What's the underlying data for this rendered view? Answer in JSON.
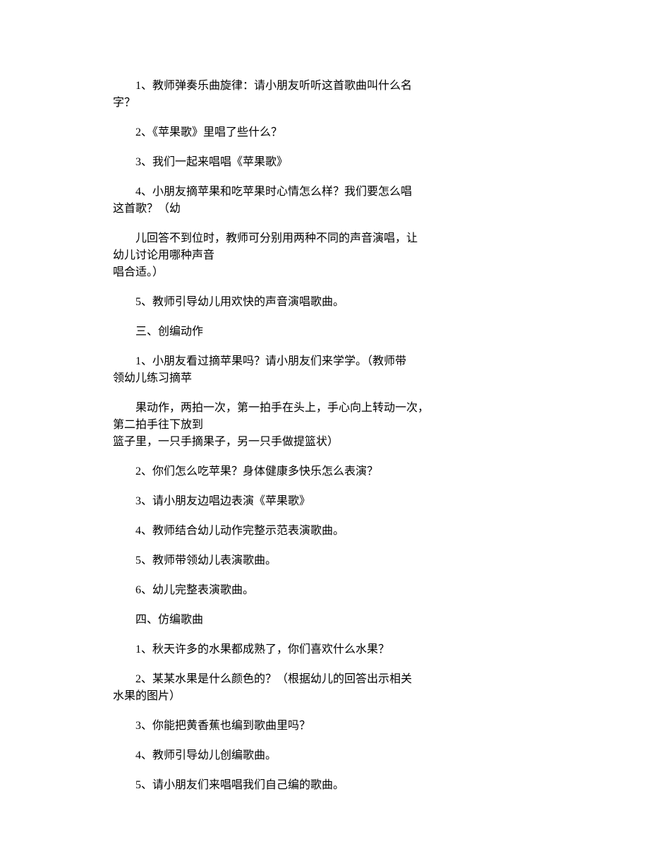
{
  "lines": {
    "p1a": "1、教师弹奏乐曲旋律：请小朋友听听这首歌曲叫什么名",
    "p1b": "字？",
    "p2": "2、《苹果歌》里唱了些什么？",
    "p3": "3、我们一起来唱唱《苹果歌》",
    "p4a": "4、小朋友摘苹果和吃苹果时心情怎么样？我们要怎么唱",
    "p4b": "这首歌？（幼",
    "p5a": "儿回答不到位时，教师可分别用两种不同的声音演唱，让",
    "p5b": "幼儿讨论用哪种声音",
    "p5c": "唱合适。）",
    "p6": "5、教师引导幼儿用欢快的声音演唱歌曲。",
    "p7": "三、创编动作",
    "p8a": "1、小朋友看过摘苹果吗？请小朋友们来学学。（教师带",
    "p8b": "领幼儿练习摘苹",
    "p9a": "果动作，两拍一次，第一拍手在头上，手心向上转动一次，",
    "p9b": "第二拍手往下放到",
    "p9c": "篮子里，一只手摘果子，另一只手做提篮状）",
    "p10": "2、你们怎么吃苹果？身体健康多快乐怎么表演？",
    "p11": "3、请小朋友边唱边表演《苹果歌》",
    "p12": "4、教师结合幼儿动作完整示范表演歌曲。",
    "p13": "5、教师带领幼儿表演歌曲。",
    "p14": "6、幼儿完整表演歌曲。",
    "p15": "四、仿编歌曲",
    "p16": "1、秋天许多的水果都成熟了，你们喜欢什么水果？",
    "p17a": "2、某某水果是什么颜色的？（根据幼儿的回答出示相关",
    "p17b": "水果的图片）",
    "p18": "3、你能把黄香蕉也编到歌曲里吗？",
    "p19": "4、教师引导幼儿创编歌曲。",
    "p20": "5、请小朋友们来唱唱我们自己编的歌曲。"
  }
}
